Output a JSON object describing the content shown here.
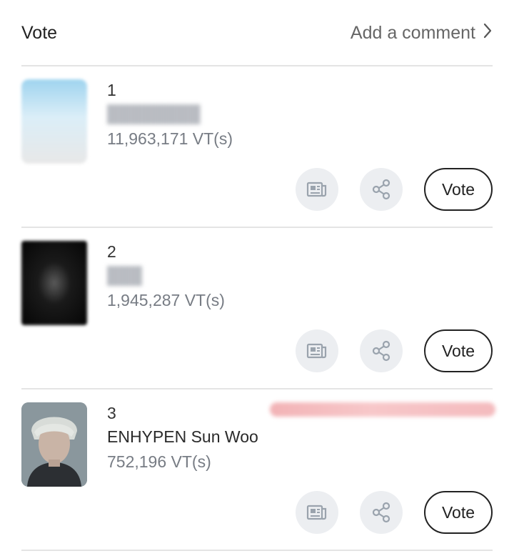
{
  "header": {
    "title": "Vote",
    "comment_link": "Add a comment"
  },
  "entries": [
    {
      "rank": "1",
      "name": "",
      "votes": "11,963,171 VT(s)",
      "vote_label": "Vote"
    },
    {
      "rank": "2",
      "name": "",
      "votes": "1,945,287 VT(s)",
      "vote_label": "Vote"
    },
    {
      "rank": "3",
      "name": "ENHYPEN Sun Woo",
      "votes": "752,196 VT(s)",
      "vote_label": "Vote"
    }
  ],
  "icons": {
    "article": "article-icon",
    "share": "share-icon",
    "chevron": "chevron-right-icon"
  },
  "colors": {
    "divider": "#e4e4e4",
    "icon_bg": "#eceef1",
    "icon_fg": "#9aa3ad",
    "secondary_text": "#777c84"
  }
}
